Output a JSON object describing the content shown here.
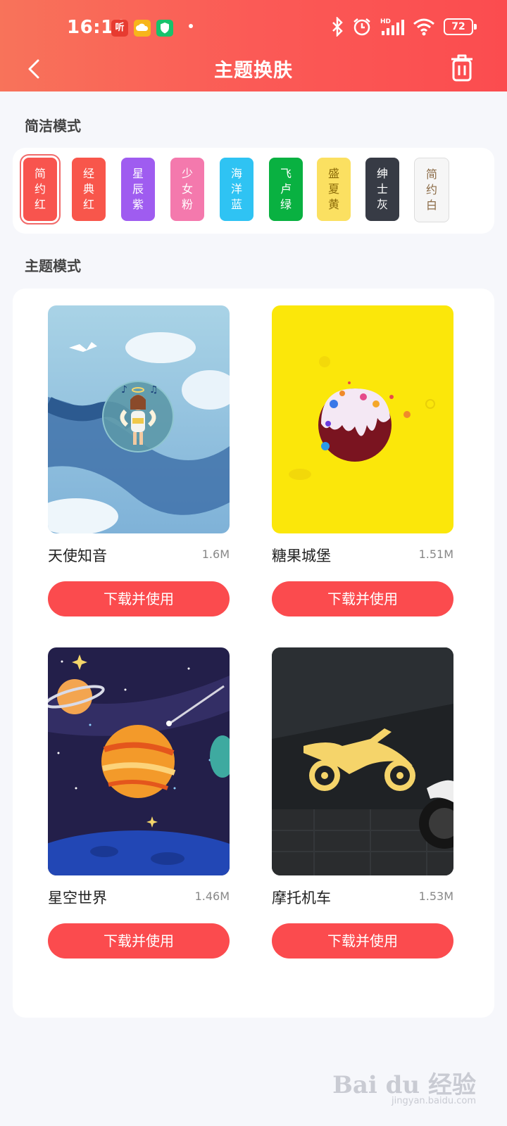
{
  "status_bar": {
    "time": "16:16",
    "app_icons": [
      "听"
    ],
    "battery": "72"
  },
  "nav": {
    "title": "主题换肤"
  },
  "simple_mode": {
    "label": "简洁模式",
    "swatches": [
      {
        "text": [
          "简",
          "约",
          "红"
        ],
        "color": "#f8544e",
        "selected": true
      },
      {
        "text": [
          "经",
          "典",
          "红"
        ],
        "color": "#f8564b"
      },
      {
        "text": [
          "星",
          "辰",
          "紫"
        ],
        "color": "#9f5cf0"
      },
      {
        "text": [
          "少",
          "女",
          "粉"
        ],
        "color": "#f479ad"
      },
      {
        "text": [
          "海",
          "洋",
          "蓝"
        ],
        "color": "#2fc3f3"
      },
      {
        "text": [
          "飞",
          "卢",
          "绿"
        ],
        "color": "#09b141"
      },
      {
        "text": [
          "盛",
          "夏",
          "黄"
        ],
        "color": "#fbe061",
        "text_color": "#8b6a08"
      },
      {
        "text": [
          "绅",
          "士",
          "灰"
        ],
        "color": "#373b45"
      },
      {
        "text": [
          "简",
          "约",
          "白"
        ],
        "color": "#f6f6f6",
        "text_color": "#8a6a45"
      }
    ]
  },
  "theme_mode": {
    "label": "主题模式",
    "items": [
      {
        "name": "天使知音",
        "size": "1.6M",
        "button": "下载并使用"
      },
      {
        "name": "糖果城堡",
        "size": "1.51M",
        "button": "下载并使用"
      },
      {
        "name": "星空世界",
        "size": "1.46M",
        "button": "下载并使用"
      },
      {
        "name": "摩托机车",
        "size": "1.53M",
        "button": "下载并使用"
      }
    ]
  },
  "watermark": {
    "logo": "Bai du 经验",
    "url": "jingyan.baidu.com"
  }
}
